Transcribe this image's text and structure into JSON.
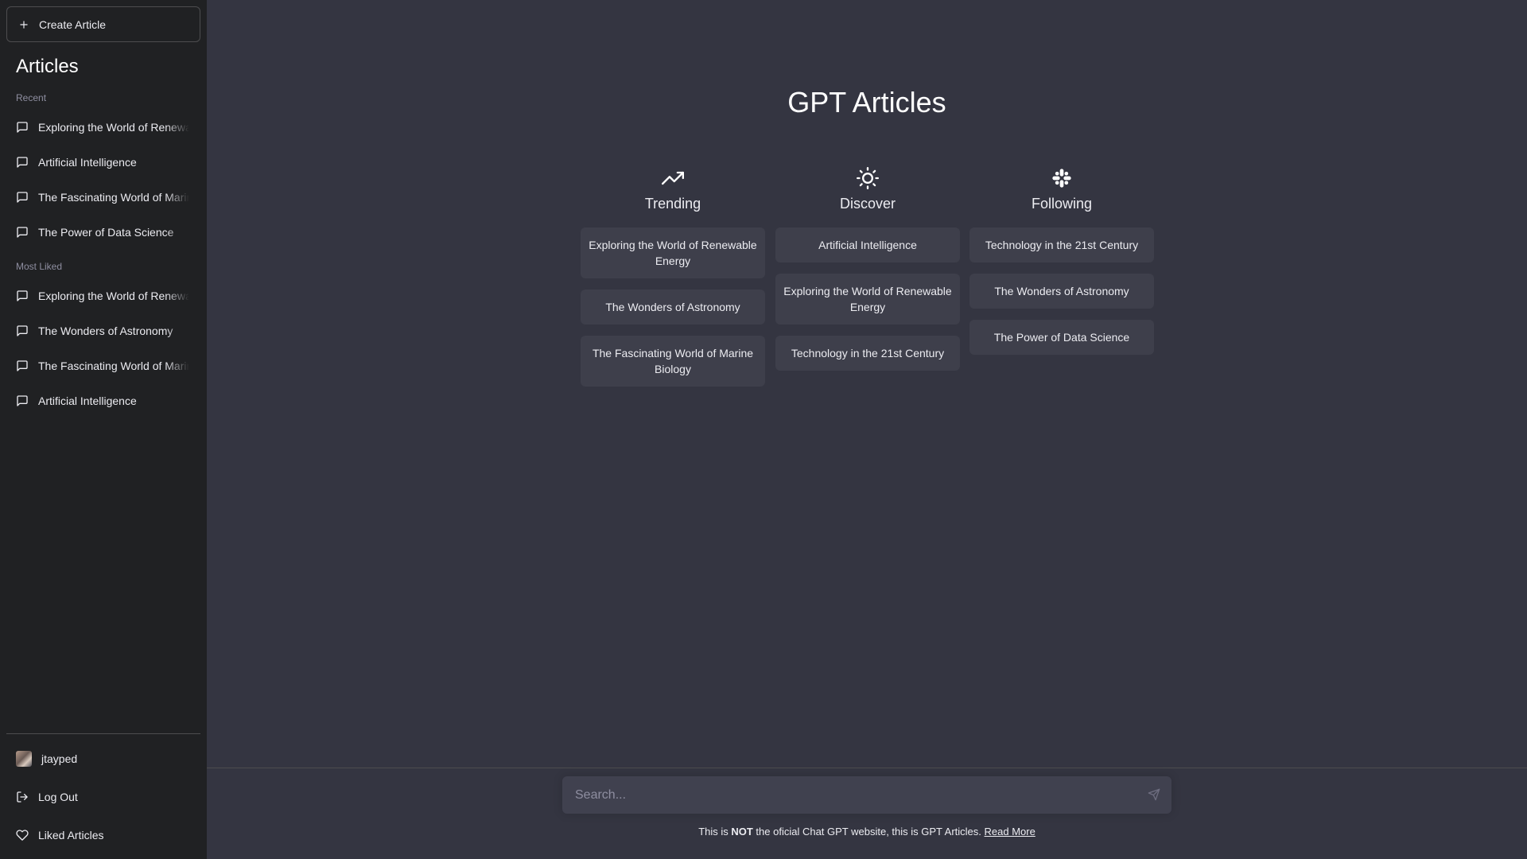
{
  "sidebar": {
    "create_label": "Create Article",
    "title": "Articles",
    "recent_label": "Recent",
    "recent": [
      "Exploring the World of Renewable Energy",
      "Artificial Intelligence",
      "The Fascinating World of Marine Biology",
      "The Power of Data Science"
    ],
    "most_liked_label": "Most Liked",
    "most_liked": [
      "Exploring the World of Renewable Energy",
      "The Wonders of Astronomy",
      "The Fascinating World of Marine Biology",
      "Artificial Intelligence"
    ],
    "username": "jtayped",
    "logout_label": "Log Out",
    "liked_label": "Liked Articles"
  },
  "main": {
    "title": "GPT Articles",
    "columns": [
      {
        "icon": "trending-up-icon",
        "title": "Trending",
        "cards": [
          "Exploring the World of Renewable Energy",
          "The Wonders of Astronomy",
          "The Fascinating World of Marine Biology"
        ]
      },
      {
        "icon": "sun-icon",
        "title": "Discover",
        "cards": [
          "Artificial Intelligence",
          "Exploring the World of Renewable Energy",
          "Technology in the 21st Century"
        ]
      },
      {
        "icon": "slack-icon",
        "title": "Following",
        "cards": [
          "Technology in the 21st Century",
          "The Wonders of Astronomy",
          "The Power of Data Science"
        ]
      }
    ]
  },
  "search": {
    "placeholder": "Search..."
  },
  "footer": {
    "prefix": "This is ",
    "bold": "NOT",
    "middle": " the oficial Chat GPT website, this is GPT Articles. ",
    "link": "Read More"
  },
  "colors": {
    "sidebar_bg": "#202123",
    "main_bg": "#343541",
    "card_bg": "#3e3f4b",
    "input_bg": "#40414f"
  }
}
